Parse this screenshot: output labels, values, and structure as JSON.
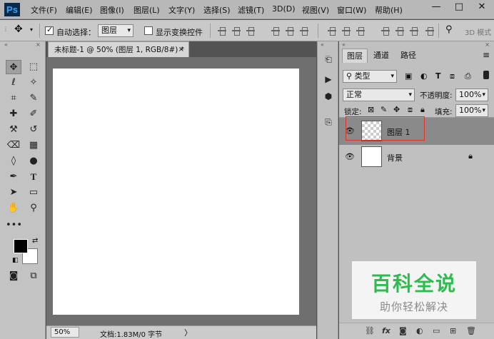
{
  "menubar": {
    "logo": "Ps",
    "items": [
      "文件(F)",
      "编辑(E)",
      "图像(I)",
      "图层(L)",
      "文字(Y)",
      "选择(S)",
      "滤镜(T)",
      "3D(D)",
      "视图(V)",
      "窗口(W)",
      "帮助(H)"
    ],
    "window_controls": {
      "minimize": "—",
      "restore": "□",
      "close": "✕"
    }
  },
  "options": {
    "auto_select_label": "自动选择：",
    "auto_select_checked": true,
    "auto_select_target": "图层",
    "show_transform_label": "显示变换控件",
    "show_transform_checked": false,
    "mode_3d": "3D 模式"
  },
  "document": {
    "tab_title": "未标题-1 @ 50% (图层 1, RGB/8#) *",
    "tab_close": "×",
    "zoom": "50%",
    "doc_info": "文档:1.83M/0 字节",
    "status_arrow": "〉"
  },
  "layers_panel": {
    "tabs": [
      "图层",
      "通道",
      "路径"
    ],
    "active_tab": "图层",
    "filter_label": "类型",
    "blend_mode": "正常",
    "opacity_label": "不透明度:",
    "opacity_value": "100%",
    "lock_label": "锁定:",
    "fill_label": "填充:",
    "fill_value": "100%",
    "layers": [
      {
        "name": "图层 1",
        "selected": true,
        "locked": false,
        "transparent": true
      },
      {
        "name": "背景",
        "selected": false,
        "locked": true,
        "transparent": false
      }
    ]
  },
  "watermark": {
    "title": "百科全说",
    "subtitle": "助你轻松解决",
    "title_color": "#2dbd4e"
  }
}
